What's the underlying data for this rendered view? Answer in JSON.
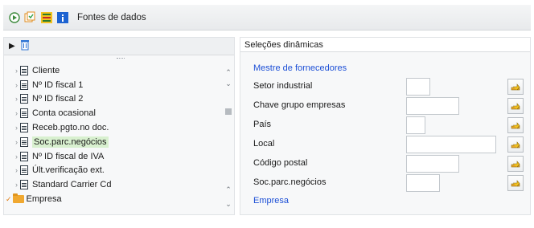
{
  "toolbar": {
    "title": "Fontes de dados",
    "icons": [
      "execute-icon",
      "dynamic-selections-icon",
      "info-icon"
    ]
  },
  "left": {
    "tree_items": [
      {
        "label": "Cliente"
      },
      {
        "label": "Nº ID fiscal 1"
      },
      {
        "label": "Nº ID fiscal 2"
      },
      {
        "label": "Conta ocasional"
      },
      {
        "label": "Receb.pgto.no doc."
      },
      {
        "label": "Soc.parc.negócios",
        "selected": true
      },
      {
        "label": "Nº ID fiscal de IVA"
      },
      {
        "label": "Últ.verificação ext."
      },
      {
        "label": "Standard Carrier Cd"
      }
    ],
    "folder_label": "Empresa"
  },
  "right": {
    "header": "Seleções dinâmicas",
    "section1": "Mestre de fornecedores",
    "fields": [
      {
        "label": "Setor industrial",
        "value": ""
      },
      {
        "label": "Chave grupo empresas",
        "value": ""
      },
      {
        "label": "País",
        "value": ""
      },
      {
        "label": "Local",
        "value": ""
      },
      {
        "label": "Código postal",
        "value": ""
      },
      {
        "label": "Soc.parc.negócios",
        "value": ""
      }
    ],
    "section2": "Empresa"
  },
  "colors": {
    "accent_blue": "#1c4fd6",
    "selected_row": "#d8f0cf",
    "folder": "#f0a830"
  }
}
